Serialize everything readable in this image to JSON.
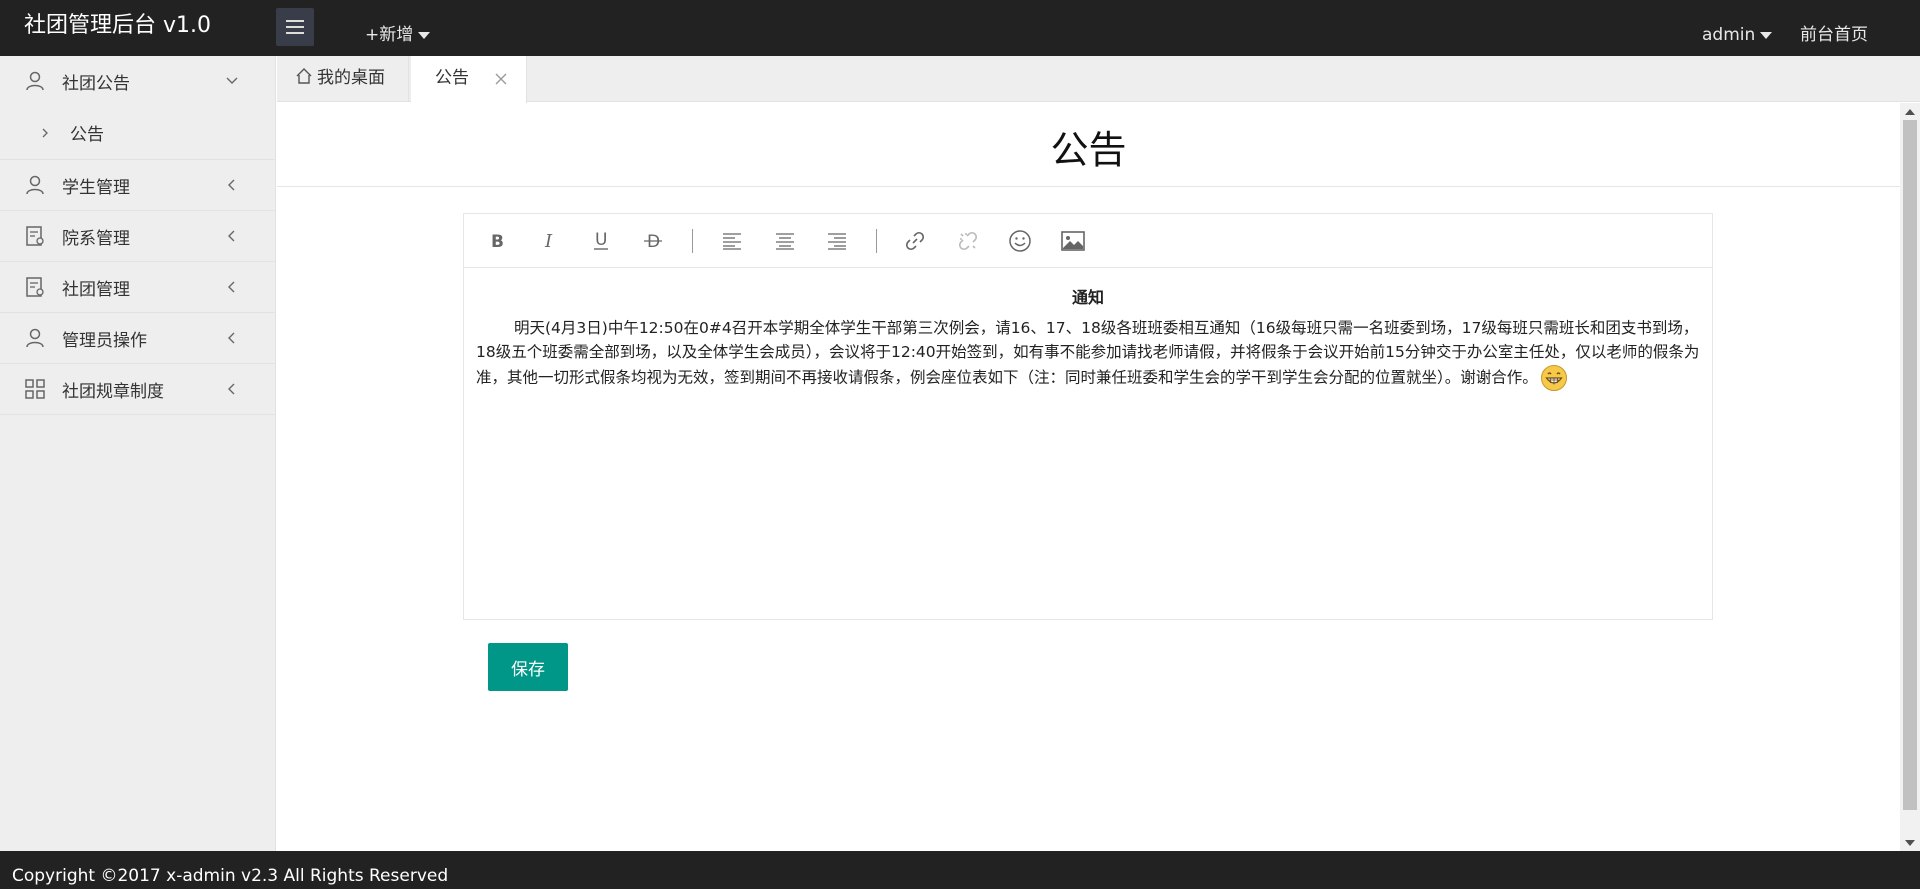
{
  "header": {
    "logo": "社团管理后台 v1.0",
    "add_new": "+新增",
    "user": "admin",
    "front_home": "前台首页"
  },
  "sidebar": {
    "items": [
      {
        "label": "社团公告",
        "icon": "user-icon",
        "expanded": true,
        "children": [
          {
            "label": "公告"
          }
        ]
      },
      {
        "label": "学生管理",
        "icon": "user-icon"
      },
      {
        "label": "院系管理",
        "icon": "document-icon"
      },
      {
        "label": "社团管理",
        "icon": "document-icon"
      },
      {
        "label": "管理员操作",
        "icon": "user-icon"
      },
      {
        "label": "社团规章制度",
        "icon": "grid-icon"
      }
    ]
  },
  "tabs": [
    {
      "label": "我的桌面",
      "icon": "home-icon"
    },
    {
      "label": "公告",
      "active": true
    }
  ],
  "page": {
    "title": "公告"
  },
  "editor": {
    "tools": [
      "bold",
      "italic",
      "underline",
      "strikethrough",
      "align-left",
      "align-center",
      "align-right",
      "link",
      "unlink",
      "emoji",
      "image"
    ],
    "heading": "通知",
    "body": "明天(4月3日)中午12:50在0#4召开本学期全体学生干部第三次例会，请16、17、18级各班班委相互通知（16级每班只需一名班委到场，17级每班只需班长和团支书到场，18级五个班委需全部到场，以及全体学生会成员），会议将于12:40开始签到，如有事不能参加请找老师请假，并将假条于会议开始前15分钟交于办公室主任处，仅以老师的假条为准，其他一切形式假条均视为无效，签到期间不再接收请假条，例会座位表如下（注：同时兼任班委和学生会的学干到学生会分配的位置就坐）。谢谢合作。"
  },
  "actions": {
    "save": "保存"
  },
  "footer": {
    "copyright": "Copyright ©2017 x-admin v2.3 All Rights Reserved"
  },
  "colors": {
    "header_bg": "#222222",
    "accent": "#009688",
    "sidebar_bg": "#eeeeee"
  }
}
